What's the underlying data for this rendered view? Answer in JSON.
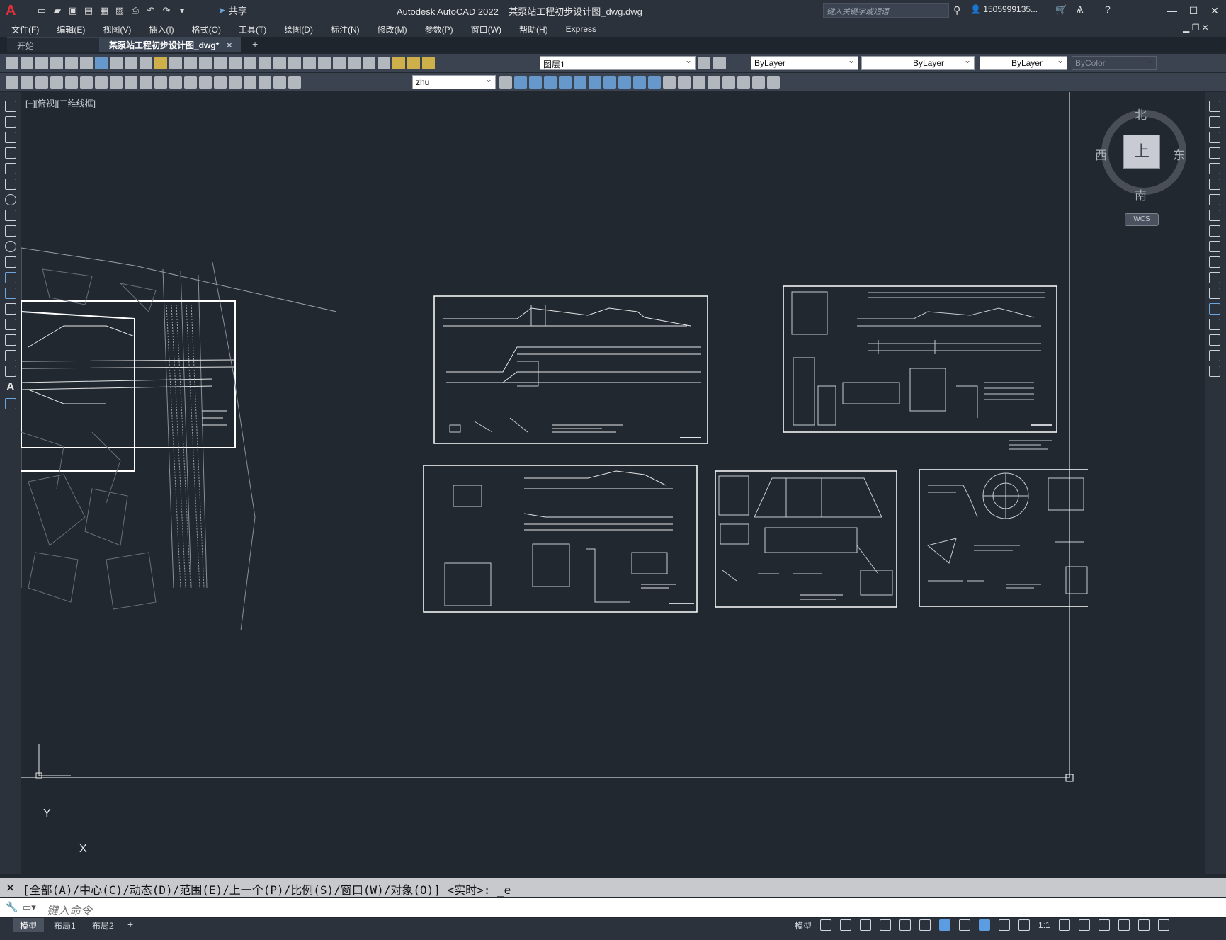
{
  "titlebar": {
    "logo": "A",
    "share_label": "共享",
    "app_title": "Autodesk AutoCAD 2022",
    "file_name": "某泵站工程初步设计图_dwg.dwg",
    "search_placeholder": "键入关键字或短语",
    "user": "1505999135...",
    "minimize": "—",
    "restore": "☐",
    "close": "✕"
  },
  "menu": [
    "文件(F)",
    "编辑(E)",
    "视图(V)",
    "插入(I)",
    "格式(O)",
    "工具(T)",
    "绘图(D)",
    "标注(N)",
    "修改(M)",
    "参数(P)",
    "窗口(W)",
    "帮助(H)",
    "Express"
  ],
  "tabs": {
    "start": "开始",
    "active": "某泵站工程初步设计图_dwg*",
    "close": "✕",
    "add": "+"
  },
  "toolbar": {
    "layer": "图层1",
    "color": "ByLayer",
    "linetype": "ByLayer",
    "lineweight": "ByLayer",
    "plotstyle": "ByColor",
    "textstyle": "zhu"
  },
  "viewport": {
    "label": "[−][俯视][二维线框]"
  },
  "viewcube": {
    "north": "北",
    "south": "南",
    "east": "东",
    "west": "西",
    "face": "上",
    "wcs": "WCS"
  },
  "ucs": {
    "y": "Y",
    "x": "X"
  },
  "command": {
    "history": "[全部(A)/中心(C)/动态(D)/范围(E)/上一个(P)/比例(S)/窗口(W)/对象(O)] <实时>: _e",
    "placeholder": "键入命令",
    "close_icon": "✕",
    "customize_icon": "🔧"
  },
  "layouts": [
    "模型",
    "布局1",
    "布局2"
  ],
  "layout_add": "+",
  "status": {
    "model": "模型",
    "scale": "1:1"
  }
}
